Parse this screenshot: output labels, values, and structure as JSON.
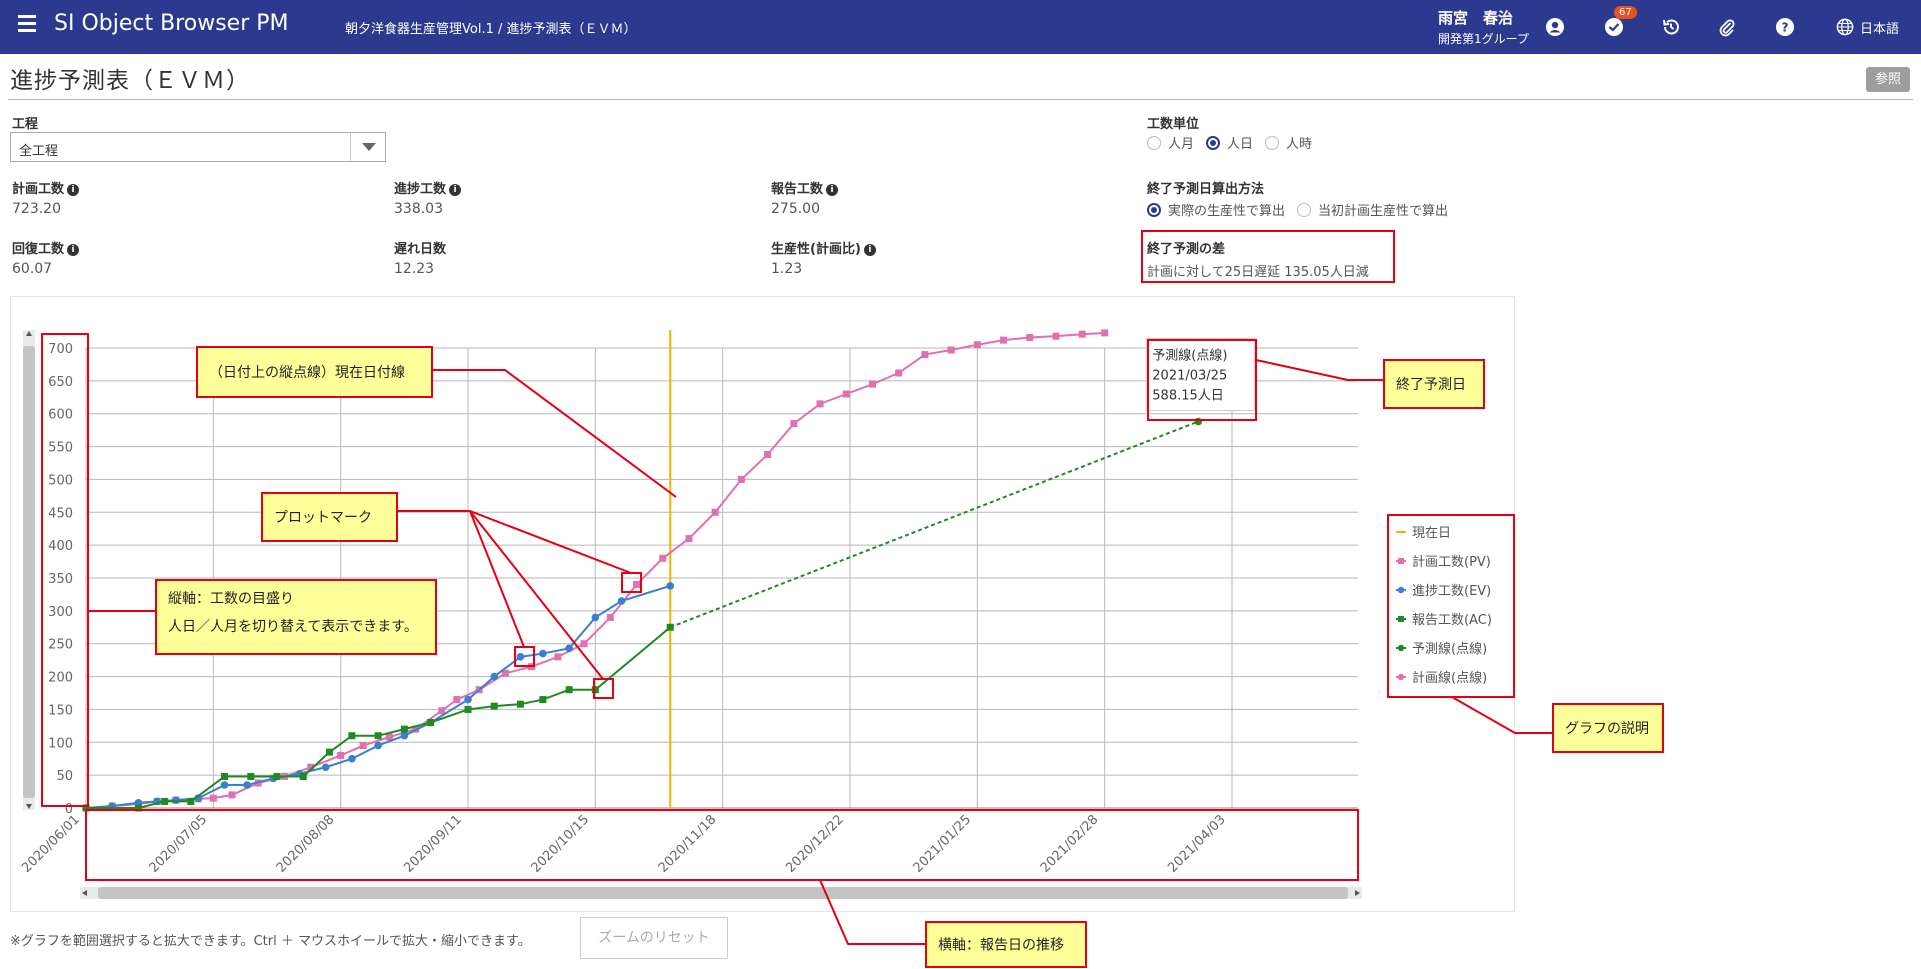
{
  "header": {
    "app_title": "SI Object Browser PM",
    "breadcrumb": "朝夕洋食器生産管理Vol.1 / 進捗予測表（ＥＶＭ）",
    "user_name": "雨宮　春治",
    "user_group": "開発第1グループ",
    "badge_count": "67",
    "language": "日本語",
    "bar_color": "#2b3a8f"
  },
  "page": {
    "title": "進捗予測表（ＥＶＭ）",
    "ref_button": "参照"
  },
  "filters": {
    "process_label": "工程",
    "process_value": "全工程",
    "unit_label": "工数単位",
    "unit_options": [
      "人月",
      "人日",
      "人時"
    ],
    "unit_selected": "人日",
    "method_label": "終了予測日算出方法",
    "method_options": [
      "実際の生産性で算出",
      "当初計画生産性で算出"
    ],
    "method_selected": "実際の生産性で算出"
  },
  "stats": {
    "planned_label": "計画工数",
    "planned_value": "723.20",
    "progress_label": "進捗工数",
    "progress_value": "338.03",
    "reported_label": "報告工数",
    "reported_value": "275.00",
    "recovery_label": "回復工数",
    "recovery_value": "60.07",
    "delay_label": "遅れ日数",
    "delay_value": "12.23",
    "productivity_label": "生産性(計画比)",
    "productivity_value": "1.23",
    "diff_label": "終了予測の差",
    "diff_value": "計画に対して25日遅延 135.05人日減"
  },
  "chart_data": {
    "type": "line",
    "y_ticks": [
      "0",
      "50",
      "100",
      "150",
      "200",
      "250",
      "300",
      "350",
      "400",
      "450",
      "500",
      "550",
      "600",
      "650",
      "700"
    ],
    "ylim": [
      0,
      700
    ],
    "x_ticks": [
      "2020/06/01",
      "2020/07/05",
      "2020/08/08",
      "2020/09/11",
      "2020/10/15",
      "2020/11/18",
      "2020/12/22",
      "2021/01/25",
      "2021/02/28",
      "2021/04/03"
    ],
    "current_date": "2020/11/04",
    "series": [
      {
        "name": "計画工数(PV)",
        "color": "#e070b0",
        "marker": "square",
        "x": [
          "2020/06/01",
          "2020/06/08",
          "2020/06/15",
          "2020/06/20",
          "2020/06/25",
          "2020/07/01",
          "2020/07/05",
          "2020/07/10",
          "2020/07/17",
          "2020/07/24",
          "2020/07/31",
          "2020/08/08",
          "2020/08/14",
          "2020/08/21",
          "2020/08/28",
          "2020/09/04",
          "2020/09/08",
          "2020/09/14",
          "2020/09/21",
          "2020/09/28",
          "2020/10/05",
          "2020/10/12",
          "2020/10/19",
          "2020/10/26",
          "2020/11/02",
          "2020/11/09",
          "2020/11/16",
          "2020/11/23",
          "2020/11/30",
          "2020/12/07",
          "2020/12/14",
          "2020/12/21",
          "2020/12/28",
          "2021/01/04",
          "2021/01/11",
          "2021/01/18",
          "2021/01/25",
          "2021/02/01",
          "2021/02/08",
          "2021/02/15",
          "2021/02/22",
          "2021/02/28"
        ],
        "values": [
          0,
          3,
          6,
          10,
          12,
          14,
          15,
          20,
          38,
          48,
          62,
          80,
          95,
          108,
          120,
          148,
          165,
          180,
          205,
          215,
          230,
          250,
          290,
          340,
          380,
          410,
          450,
          500,
          538,
          585,
          615,
          630,
          645,
          662,
          690,
          697,
          705,
          712,
          716,
          718,
          721,
          723
        ]
      },
      {
        "name": "進捗工数(EV)",
        "color": "#3a7fd0",
        "marker": "circle",
        "x": [
          "2020/06/01",
          "2020/06/08",
          "2020/06/15",
          "2020/06/20",
          "2020/06/25",
          "2020/07/01",
          "2020/07/08",
          "2020/07/14",
          "2020/07/21",
          "2020/07/28",
          "2020/08/04",
          "2020/08/11",
          "2020/08/18",
          "2020/08/25",
          "2020/09/01",
          "2020/09/11",
          "2020/09/18",
          "2020/09/25",
          "2020/10/01",
          "2020/10/08",
          "2020/10/15",
          "2020/10/22",
          "2020/11/04"
        ],
        "values": [
          0,
          3,
          8,
          10,
          12,
          15,
          35,
          35,
          45,
          52,
          62,
          75,
          95,
          110,
          130,
          165,
          200,
          230,
          235,
          243,
          290,
          315,
          338
        ]
      },
      {
        "name": "報告工数(AC)",
        "color": "#1f8a1f",
        "marker": "square",
        "x": [
          "2020/06/01",
          "2020/06/15",
          "2020/06/22",
          "2020/06/29",
          "2020/07/08",
          "2020/07/15",
          "2020/07/22",
          "2020/07/29",
          "2020/08/05",
          "2020/08/11",
          "2020/08/18",
          "2020/08/25",
          "2020/09/01",
          "2020/09/11",
          "2020/09/18",
          "2020/09/25",
          "2020/10/01",
          "2020/10/08",
          "2020/10/15",
          "2020/11/04"
        ],
        "values": [
          0,
          0,
          10,
          10,
          48,
          48,
          48,
          48,
          85,
          110,
          110,
          120,
          130,
          150,
          155,
          158,
          165,
          180,
          180,
          275
        ]
      },
      {
        "name": "予測線(点線)",
        "color": "#1f8a1f",
        "marker": "circle",
        "dashed": true,
        "x": [
          "2020/11/04",
          "2021/03/25"
        ],
        "values": [
          275,
          588.15
        ]
      },
      {
        "name": "計画線(点線)",
        "color": "#e070b0",
        "marker": "circle",
        "dashed": true,
        "x": [],
        "values": []
      }
    ],
    "legend": [
      "現在日",
      "計画工数(PV)",
      "進捗工数(EV)",
      "報告工数(AC)",
      "予測線(点線)",
      "計画線(点線)"
    ],
    "legend_position": "right",
    "tooltip": {
      "title": "予測線(点線)",
      "date": "2021/03/25",
      "value": "588.15人日"
    },
    "current_line_color": "#f0b400",
    "grid": true
  },
  "annotations": {
    "current_date_line": "（日付上の縦点線）現在日付線",
    "plot_mark": "プロットマーク",
    "vertical_axis_1": "縦軸：工数の目盛り",
    "vertical_axis_2": "人日／人月を切り替えて表示できます。",
    "end_forecast": "終了予測日",
    "graph_legend": "グラフの説明",
    "horizontal_axis": "横軸：報告日の推移"
  },
  "footer": {
    "note": "※グラフを範囲選択すると拡大できます。Ctrl ＋ マウスホイールで拡大・縮小できます。",
    "zoom_reset": "ズームのリセット"
  }
}
